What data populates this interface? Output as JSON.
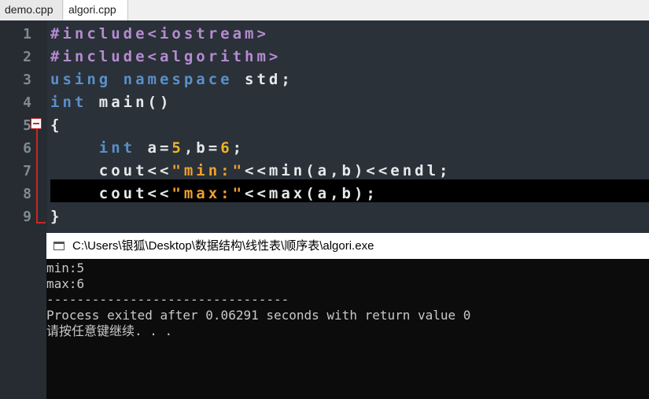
{
  "tabs": [
    {
      "label": "demo.cpp"
    },
    {
      "label": "algori.cpp"
    }
  ],
  "editor": {
    "line_numbers": [
      "1",
      "2",
      "3",
      "4",
      "5",
      "6",
      "7",
      "8",
      "9"
    ],
    "lines": [
      [
        {
          "t": "#include<iostream>",
          "c": "pp"
        }
      ],
      [
        {
          "t": "#include<algorithm>",
          "c": "pp"
        }
      ],
      [
        {
          "t": "using namespace ",
          "c": "kw"
        },
        {
          "t": "std;",
          "c": "tx"
        }
      ],
      [
        {
          "t": "int ",
          "c": "kw"
        },
        {
          "t": "main()",
          "c": "tx"
        }
      ],
      [
        {
          "t": "{",
          "c": "tx"
        }
      ],
      [
        {
          "t": "    int ",
          "c": "kw"
        },
        {
          "t": "a=",
          "c": "tx"
        },
        {
          "t": "5",
          "c": "num"
        },
        {
          "t": ",b=",
          "c": "tx"
        },
        {
          "t": "6",
          "c": "num"
        },
        {
          "t": ";",
          "c": "tx"
        }
      ],
      [
        {
          "t": "    cout<<",
          "c": "tx"
        },
        {
          "t": "\"min:\"",
          "c": "str"
        },
        {
          "t": "<<min(a,b)<<endl;",
          "c": "tx"
        }
      ],
      [
        {
          "t": "    cout<<",
          "c": "tx"
        },
        {
          "t": "\"max:\"",
          "c": "str"
        },
        {
          "t": "<<max(a,b);",
          "c": "tx"
        }
      ],
      [
        {
          "t": "}",
          "c": "tx"
        }
      ]
    ]
  },
  "console": {
    "title": "C:\\Users\\银狐\\Desktop\\数据结构\\线性表\\顺序表\\algori.exe",
    "output": "min:5\nmax:6\n--------------------------------\nProcess exited after 0.06291 seconds with return value 0\n请按任意键继续. . ."
  }
}
